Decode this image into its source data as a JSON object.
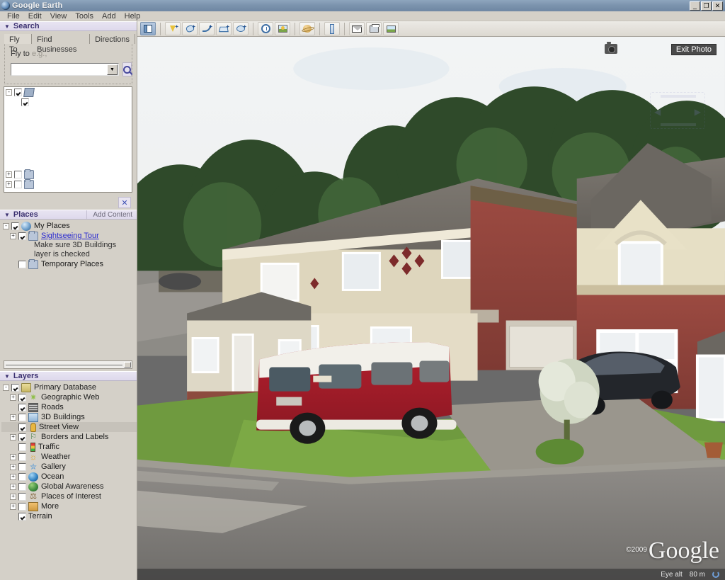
{
  "window": {
    "title": "Google Earth",
    "minimize_label": "_",
    "restore_label": "❐",
    "close_label": "✕"
  },
  "menubar": {
    "items": [
      {
        "label": "File"
      },
      {
        "label": "Edit"
      },
      {
        "label": "View"
      },
      {
        "label": "Tools"
      },
      {
        "label": "Add"
      },
      {
        "label": "Help"
      }
    ]
  },
  "toolbar": {
    "items": [
      {
        "name": "toggle-sidebar",
        "title": "Show sidebar"
      },
      {
        "name": "add-placemark",
        "title": "Add Placemark"
      },
      {
        "name": "add-polygon",
        "title": "Add Polygon"
      },
      {
        "name": "add-path",
        "title": "Add Path"
      },
      {
        "name": "add-image-overlay",
        "title": "Add Image Overlay"
      },
      {
        "name": "record-tour",
        "title": "Record a Tour"
      },
      {
        "name": "historical-imagery",
        "title": "Show historical imagery"
      },
      {
        "name": "sunlight",
        "title": "Show sunlight across the landscape"
      },
      {
        "name": "switch-planet",
        "title": "Switch between Earth, Sky and other planets"
      },
      {
        "name": "ruler",
        "title": "Show ruler"
      },
      {
        "name": "email",
        "title": "Email"
      },
      {
        "name": "print",
        "title": "Print"
      },
      {
        "name": "save-image",
        "title": "Save Image"
      }
    ]
  },
  "search": {
    "header": "Search",
    "tabs": [
      {
        "label": "Fly To",
        "active": true
      },
      {
        "label": "Find Businesses",
        "active": false
      },
      {
        "label": "Directions",
        "active": false
      }
    ],
    "flyto_label": "Fly to",
    "flyto_hint": "e.g.,",
    "input_value": "",
    "input_placeholder": "",
    "close_label": "✕",
    "results": [
      {
        "label": "",
        "expander": "-",
        "checked": true,
        "icon": "folder-open-icon",
        "indent": 0
      },
      {
        "label": "",
        "expander": "",
        "checked": true,
        "icon": "checkbox-only",
        "indent": 1
      },
      {
        "label": "",
        "expander": "+",
        "checked": false,
        "icon": "folder-icon",
        "indent": 0
      },
      {
        "label": "",
        "expander": "+",
        "checked": false,
        "icon": "folder-icon",
        "indent": 0
      }
    ]
  },
  "places": {
    "header": "Places",
    "add_content_label": "Add Content",
    "items": [
      {
        "label": "My Places",
        "expander": "-",
        "checked": true,
        "icon": "globe-icon",
        "indent": 0,
        "link": false
      },
      {
        "label": "Sightseeing Tour",
        "expander": "+",
        "checked": true,
        "icon": "folder-icon",
        "indent": 1,
        "link": true
      },
      {
        "label": "Temporary Places",
        "expander": "",
        "checked": false,
        "icon": "folder-icon",
        "indent": 1,
        "link": false
      }
    ],
    "note_line1": "Make sure 3D Buildings",
    "note_line2": "layer is checked"
  },
  "layers": {
    "header": "Layers",
    "items": [
      {
        "label": "Primary Database",
        "expander": "-",
        "checked": true,
        "icon": "database-icon",
        "indent": 0,
        "selected": false
      },
      {
        "label": "Geographic Web",
        "expander": "+",
        "checked": true,
        "icon": "star-icon",
        "indent": 1,
        "selected": false
      },
      {
        "label": "Roads",
        "expander": "",
        "checked": true,
        "icon": "road-icon",
        "indent": 1,
        "selected": false
      },
      {
        "label": "3D Buildings",
        "expander": "+",
        "checked": false,
        "icon": "building-icon",
        "indent": 1,
        "selected": false
      },
      {
        "label": "Street View",
        "expander": "",
        "checked": true,
        "icon": "pegman-icon",
        "indent": 1,
        "selected": true
      },
      {
        "label": "Borders and Labels",
        "expander": "+",
        "checked": true,
        "icon": "flag-icon",
        "indent": 1,
        "selected": false
      },
      {
        "label": "Traffic",
        "expander": "",
        "checked": false,
        "icon": "traffic-light-icon",
        "indent": 1,
        "selected": false
      },
      {
        "label": "Weather",
        "expander": "+",
        "checked": false,
        "icon": "sun-icon",
        "indent": 1,
        "selected": false
      },
      {
        "label": "Gallery",
        "expander": "+",
        "checked": false,
        "icon": "gallery-icon",
        "indent": 1,
        "selected": false
      },
      {
        "label": "Ocean",
        "expander": "+",
        "checked": false,
        "icon": "ocean-icon",
        "indent": 1,
        "selected": false
      },
      {
        "label": "Global Awareness",
        "expander": "+",
        "checked": false,
        "icon": "awareness-icon",
        "indent": 1,
        "selected": false
      },
      {
        "label": "Places of Interest",
        "expander": "+",
        "checked": false,
        "icon": "poi-icon",
        "indent": 1,
        "selected": false
      },
      {
        "label": "More",
        "expander": "+",
        "checked": false,
        "icon": "more-icon",
        "indent": 1,
        "selected": false
      },
      {
        "label": "Terrain",
        "expander": "",
        "checked": true,
        "icon": "none",
        "indent": 1,
        "selected": false
      }
    ]
  },
  "viewport": {
    "exit_photo_label": "Exit Photo",
    "camera_icon": "camera-icon",
    "watermark_copyright": "©2009",
    "watermark_text": "Google",
    "status": {
      "eye_alt_label": "Eye alt",
      "eye_alt_value": "80 m"
    },
    "scene_description": "Street View photo of a suburban cul-de-sac with red-brick and cream rendered houses, a red and white VW camper van and a dark car on a driveway"
  },
  "colors": {
    "accent": "#3b3070",
    "link": "#2a2ad0",
    "chrome": "#d4d0c8",
    "titlebar": "#7b93ad",
    "selection": "#c6c2ba"
  }
}
